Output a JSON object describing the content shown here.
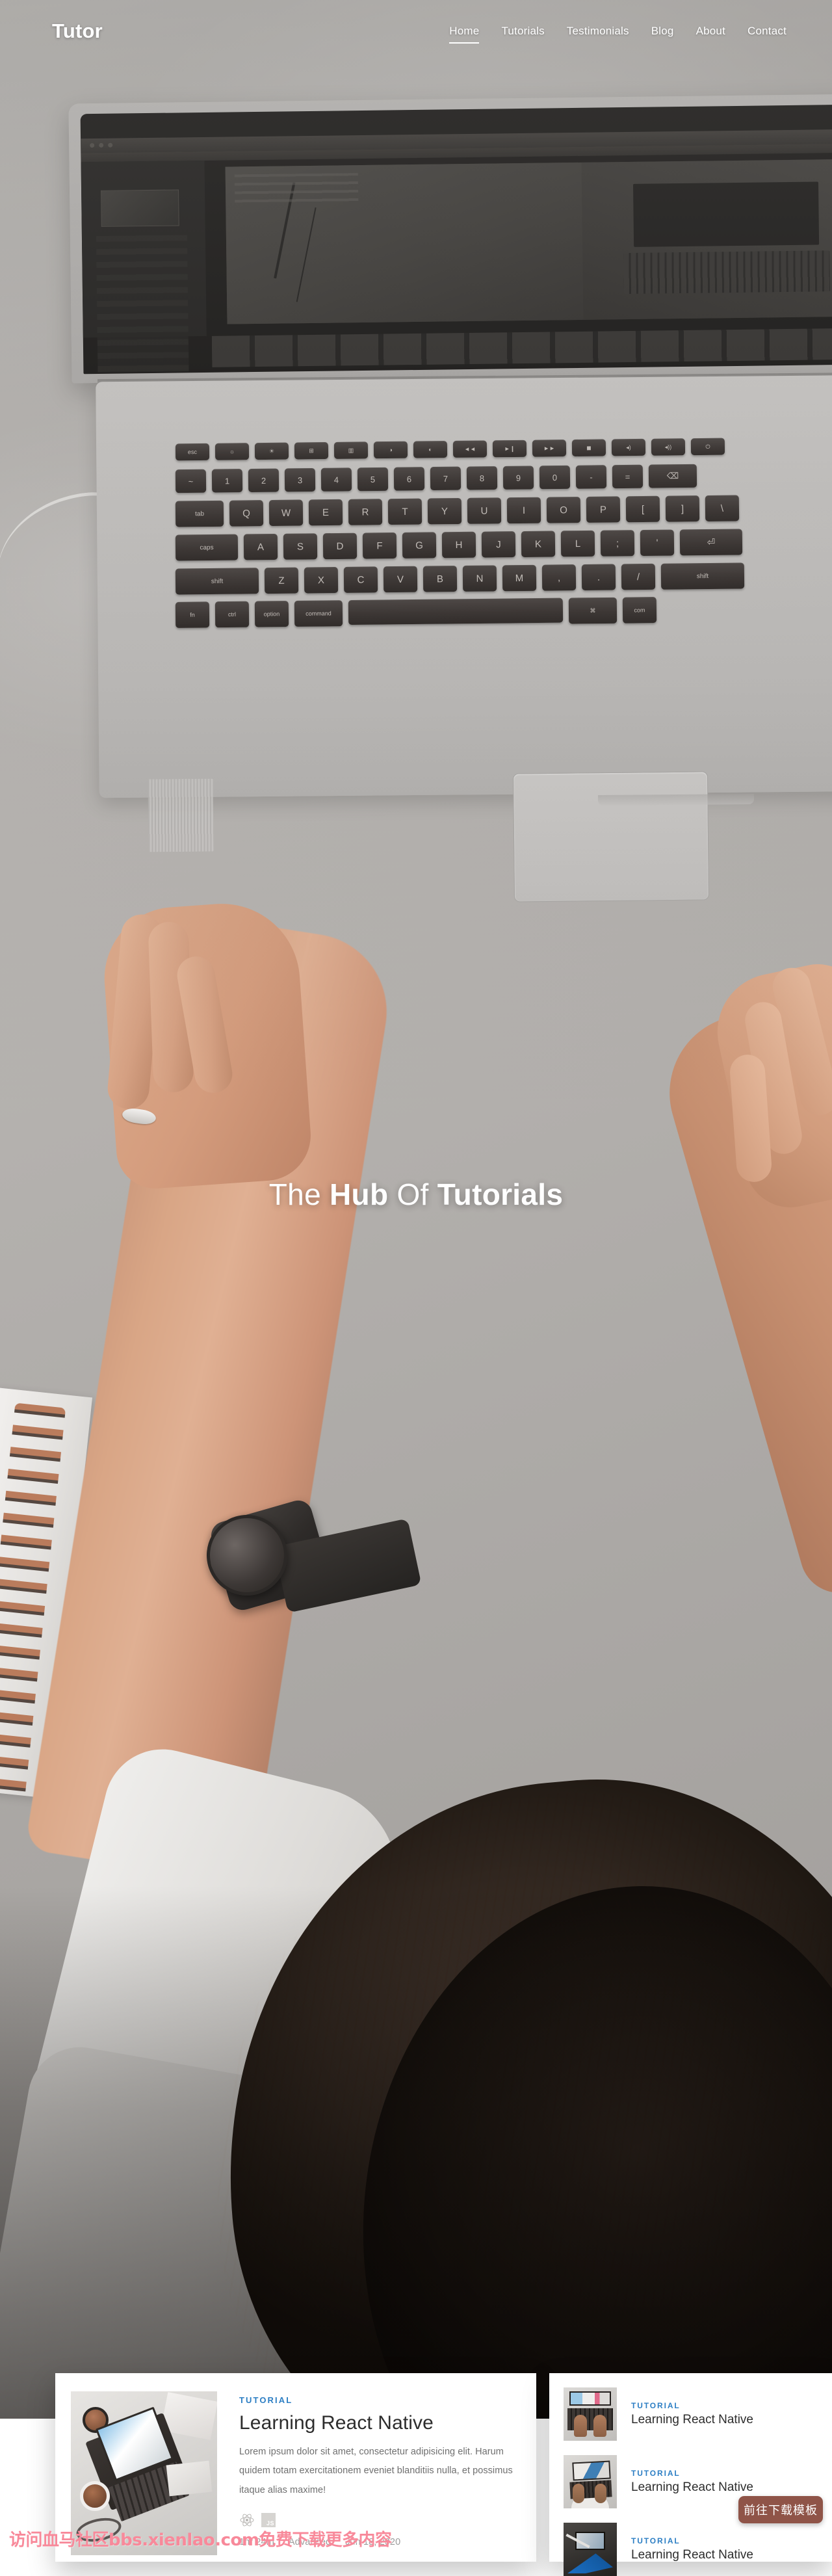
{
  "header": {
    "logo": "Tutor",
    "nav": [
      {
        "label": "Home",
        "active": true
      },
      {
        "label": "Tutorials",
        "active": false
      },
      {
        "label": "Testimonials",
        "active": false
      },
      {
        "label": "Blog",
        "active": false
      },
      {
        "label": "About",
        "active": false
      },
      {
        "label": "Contact",
        "active": false
      }
    ]
  },
  "hero": {
    "title_part1": "The ",
    "title_part2": "Hub",
    "title_part3": " Of ",
    "title_part4": "Tutorials"
  },
  "main_card": {
    "eyebrow": "TUTORIAL",
    "title": "Learning React Native",
    "description": "Lorem ipsum dolor sit amet, consectetur adipisicing elit. Harum quidem totam exercitationem eveniet blanditiis nulla, et possimus itaque alias maxime!",
    "tech": [
      {
        "name": "react-icon",
        "label": "React"
      },
      {
        "name": "js-icon",
        "label": "JS"
      }
    ],
    "meta": {
      "duration": "1hr 24m",
      "level": "Advanced",
      "date": "Jun 18, 2020"
    }
  },
  "side_cards": [
    {
      "eyebrow": "TUTORIAL",
      "title": "Learning React Native"
    },
    {
      "eyebrow": "TUTORIAL",
      "title": "Learning React Native"
    },
    {
      "eyebrow": "TUTORIAL",
      "title": "Learning React Native"
    }
  ],
  "overlay": {
    "download_button": "前往下载模板",
    "watermark": "访问血马社区bbs.xienlao.com免费下载更多内容"
  },
  "keyboard": {
    "fn_row": [
      "esc",
      "☀",
      "☼",
      "⊞",
      "▥",
      "◑",
      "◐",
      "◄◄",
      "►❙"
    ],
    "num_row": [
      "~\n`",
      "!\n1",
      "@\n2",
      "#\n3",
      "$\n4",
      "%\n5",
      "^\n6",
      "&\n7",
      "*\n8",
      "(\n9"
    ],
    "row_q": [
      "tab",
      "Q",
      "W",
      "E",
      "R",
      "T",
      "Y",
      "U",
      "I"
    ],
    "row_a": [
      "caps",
      "A",
      "S",
      "D",
      "F",
      "G",
      "H",
      "J",
      "K"
    ],
    "row_z": [
      "shift",
      "Z",
      "X",
      "C",
      "V",
      "B",
      "N",
      "M"
    ],
    "row_space": [
      "fn",
      "ctrl",
      "option",
      "command",
      "",
      "⌘",
      "com"
    ]
  },
  "colors": {
    "accent_blue": "#2d7fc4",
    "card_bg": "#ffffff",
    "title_text": "#2d2d2d",
    "body_text": "#6f6f6f",
    "meta_text": "#9b9b9b",
    "download_btn": "#8f5448",
    "watermark_pink": "#f8899a"
  }
}
